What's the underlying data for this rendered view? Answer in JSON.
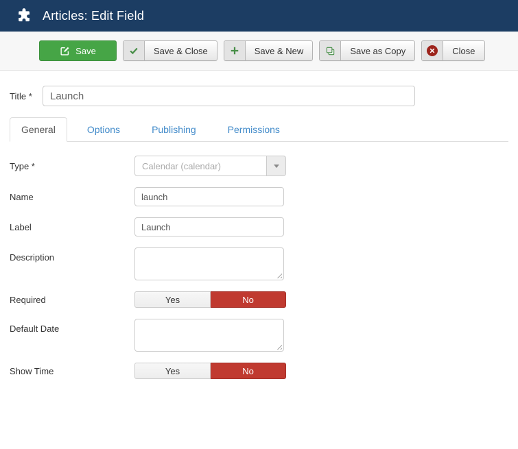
{
  "header": {
    "title": "Articles: Edit Field",
    "icon": "puzzle-piece-icon"
  },
  "toolbar": {
    "buttons": [
      {
        "label": "Save",
        "icon": "pencil-square-icon",
        "style": "success"
      },
      {
        "label": "Save & Close",
        "icon": "check-icon",
        "style": "default"
      },
      {
        "label": "Save & New",
        "icon": "plus-icon",
        "style": "default"
      },
      {
        "label": "Save as Copy",
        "icon": "copy-icon",
        "style": "default"
      },
      {
        "label": "Close",
        "icon": "cancel-circle-icon",
        "style": "default"
      }
    ]
  },
  "title_field": {
    "label": "Title *",
    "value": "Launch"
  },
  "tabs": [
    {
      "label": "General",
      "active": true
    },
    {
      "label": "Options",
      "active": false
    },
    {
      "label": "Publishing",
      "active": false
    },
    {
      "label": "Permissions",
      "active": false
    }
  ],
  "form": {
    "type": {
      "label": "Type *",
      "value": "Calendar (calendar)",
      "disabled": true
    },
    "name": {
      "label": "Name",
      "value": "launch"
    },
    "label_field": {
      "label": "Label",
      "value": "Launch"
    },
    "description": {
      "label": "Description",
      "value": ""
    },
    "required": {
      "label": "Required",
      "options": [
        "Yes",
        "No"
      ],
      "selected": "No"
    },
    "default_date": {
      "label": "Default Date",
      "value": ""
    },
    "show_time": {
      "label": "Show Time",
      "options": [
        "Yes",
        "No"
      ],
      "selected": "No"
    }
  },
  "colors": {
    "header_bg": "#1c3d63",
    "save_green": "#46a546",
    "toggle_red": "#c03a30",
    "link_blue": "#428bca",
    "close_icon_red": "#9d241c",
    "icon_green": "#478e47"
  }
}
